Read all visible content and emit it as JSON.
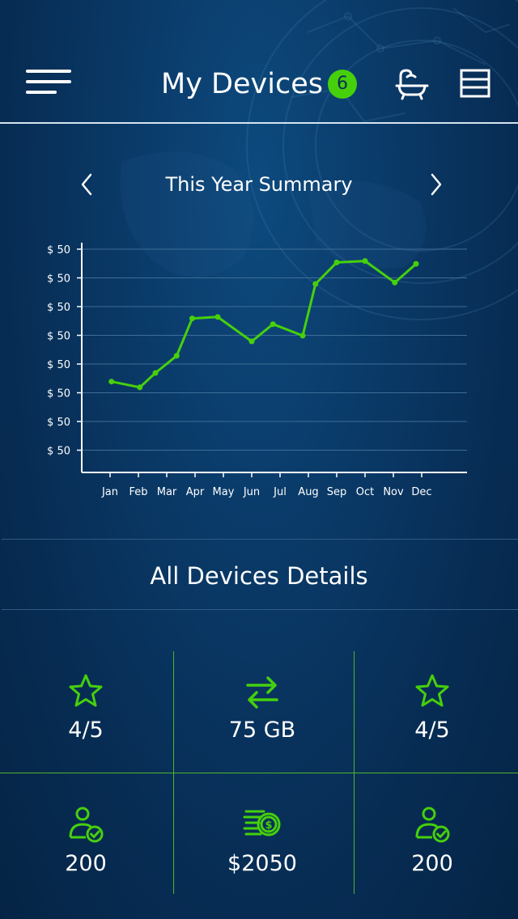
{
  "header": {
    "title": "My Devices",
    "badge_count": "6",
    "icons": [
      "menu-icon",
      "bathtub-shower-icon",
      "list-icon"
    ]
  },
  "summary": {
    "title": "This Year Summary",
    "prev_icon": "chevron-left-icon",
    "next_icon": "chevron-right-icon"
  },
  "chart_data": {
    "type": "line",
    "categories": [
      "Jan",
      "Feb",
      "Mar",
      "Apr",
      "May",
      "Jun",
      "Jul",
      "Aug",
      "Sep",
      "Oct",
      "Nov",
      "Dec"
    ],
    "y_tick_labels": [
      "$ 50",
      "$ 50",
      "$ 50",
      "$ 50",
      "$ 50",
      "$ 50",
      "$ 50",
      "$ 50"
    ],
    "ylim": [
      0,
      8
    ],
    "points": [
      {
        "x": 0.05,
        "y": 2.4
      },
      {
        "x": 1.05,
        "y": 2.2
      },
      {
        "x": 1.6,
        "y": 2.7
      },
      {
        "x": 2.35,
        "y": 3.3
      },
      {
        "x": 2.9,
        "y": 4.6
      },
      {
        "x": 3.8,
        "y": 4.65
      },
      {
        "x": 5.0,
        "y": 3.8
      },
      {
        "x": 5.75,
        "y": 4.4
      },
      {
        "x": 6.8,
        "y": 4.0
      },
      {
        "x": 7.25,
        "y": 5.8
      },
      {
        "x": 8.0,
        "y": 6.55
      },
      {
        "x": 9.0,
        "y": 6.6
      },
      {
        "x": 10.05,
        "y": 5.85
      },
      {
        "x": 10.8,
        "y": 6.5
      }
    ],
    "line_color": "#46d00c",
    "grid": true
  },
  "details": {
    "title": "All Devices Details",
    "stats": [
      {
        "icon": "star-icon",
        "value": "4/5"
      },
      {
        "icon": "transfer-arrows-icon",
        "value": "75 GB"
      },
      {
        "icon": "star-icon",
        "value": "4/5"
      },
      {
        "icon": "user-check-icon",
        "value": "200"
      },
      {
        "icon": "money-coin-icon",
        "value": "$2050"
      },
      {
        "icon": "user-check-icon",
        "value": "200"
      }
    ]
  },
  "colors": {
    "accent": "#46d00c",
    "background": "#0a3a68"
  }
}
